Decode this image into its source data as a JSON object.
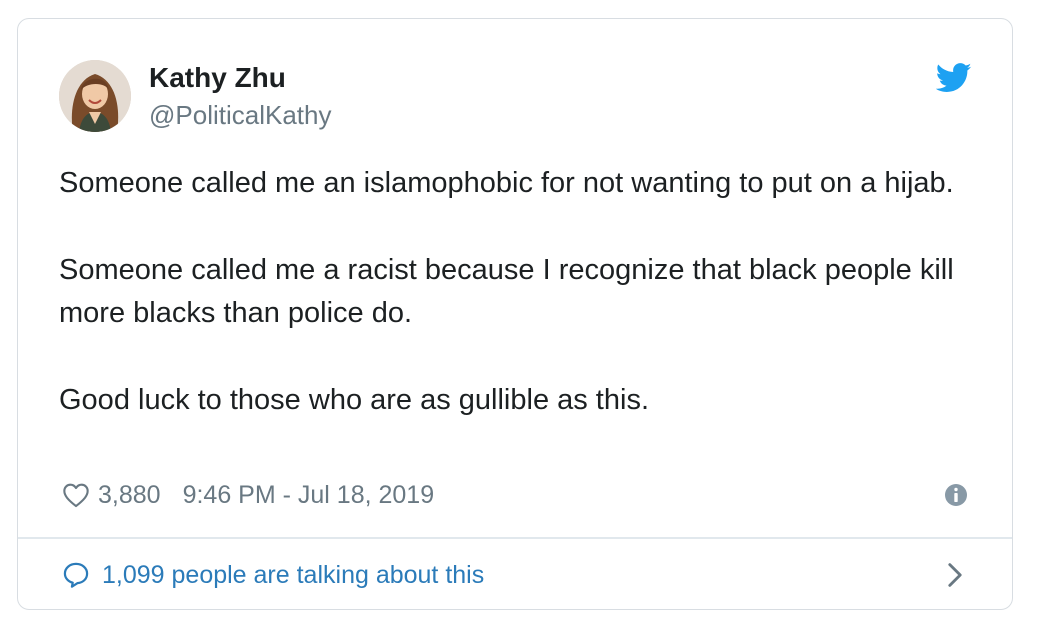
{
  "tweet": {
    "author": {
      "display_name": "Kathy Zhu",
      "handle": "@PoliticalKathy",
      "avatar_icon": "profile-photo"
    },
    "paragraphs": [
      "Someone called me an islamophobic for not wanting to put on a hijab.",
      "Someone called me a racist because I recognize that black people kill more blacks than police do.",
      "Good luck to those who are as gullible as this."
    ],
    "likes": "3,880",
    "timestamp": "9:46 PM - Jul 18, 2019",
    "talking": "1,099 people are talking about this"
  },
  "colors": {
    "text": "#1c2022",
    "muted": "#697882",
    "link": "#2b7bb9",
    "twitter_blue": "#1da1f2",
    "border": "#d8dde2"
  },
  "icons": {
    "brand": "twitter-bird-icon",
    "like": "heart-icon",
    "info": "info-icon",
    "comment": "speech-bubble-icon",
    "next": "chevron-right-icon"
  }
}
